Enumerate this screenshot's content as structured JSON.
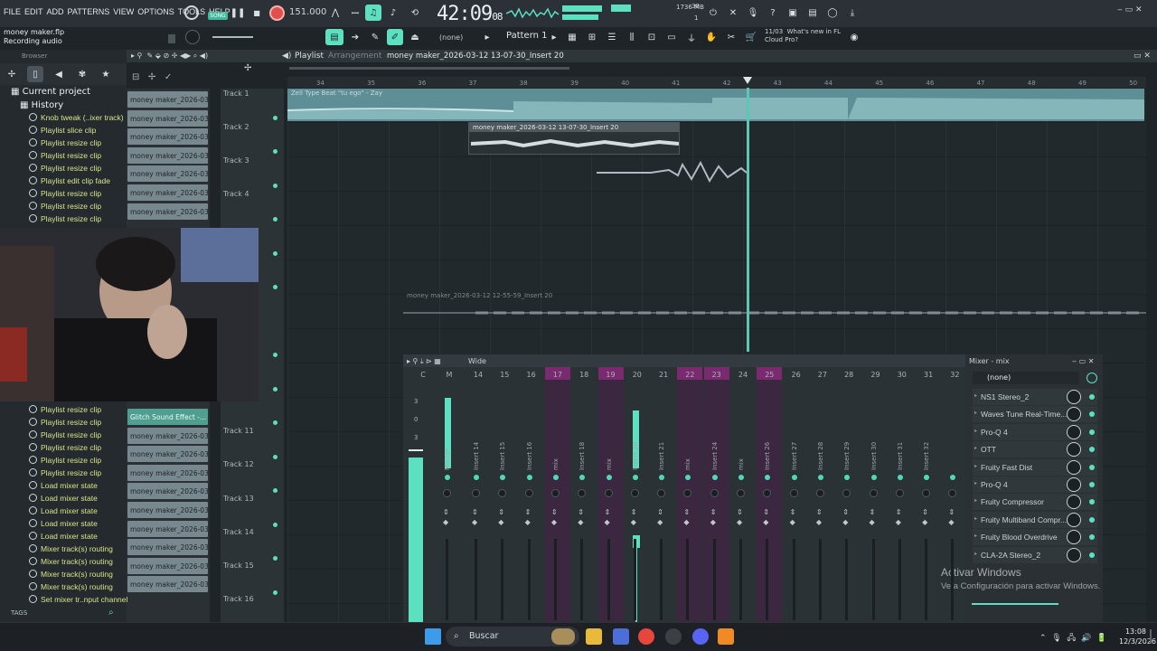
{
  "menu": [
    "FILE",
    "EDIT",
    "ADD",
    "PATTERNS",
    "VIEW",
    "OPTIONS",
    "TOOLS",
    "HELP"
  ],
  "project": {
    "name": "money maker.flp",
    "status": "Recording audio"
  },
  "transport": {
    "tempo": "151.000",
    "time_main": "42:09",
    "time_sub": "08",
    "song_label": "SONG",
    "pattern_label": "PAT"
  },
  "cpu": {
    "top": "38",
    "mem": "1736 MB",
    "bottom": "1"
  },
  "toolbar": {
    "snap": "(none)",
    "pattern": "Pattern 1"
  },
  "news": {
    "date": "11/03",
    "line1": "What's new in FL",
    "line2": "Cloud Pro?"
  },
  "browser": {
    "label": "Browser",
    "current_project": "Current project",
    "history": "History",
    "items_top": [
      "Knob tweak (..ixer track)",
      "Playlist slice clip",
      "Playlist resize clip",
      "Playlist resize clip",
      "Playlist resize clip",
      "Playlist edit clip fade",
      "Playlist resize clip",
      "Playlist resize clip",
      "Playlist resize clip"
    ],
    "items_bottom": [
      "Playlist resize clip",
      "Playlist resize clip",
      "Playlist resize clip",
      "Playlist resize clip",
      "Playlist resize clip",
      "Playlist resize clip",
      "Load mixer state",
      "Load mixer state",
      "Load mixer state",
      "Load mixer state",
      "Load mixer state",
      "Mixer track(s) routing",
      "Mixer track(s) routing",
      "Mixer track(s) routing",
      "Mixer track(s) routing",
      "Set mixer tr..nput channel"
    ],
    "tags": "TAGS"
  },
  "playlist": {
    "title": "Playlist",
    "view": "Arrangement",
    "file": "money maker_2026-03-12 13-07-30_Insert 20",
    "ticks": [
      "34",
      "35",
      "36",
      "37",
      "38",
      "39",
      "40",
      "41",
      "42",
      "43",
      "44",
      "45",
      "46",
      "47",
      "48",
      "49",
      "50"
    ],
    "tracks_top": [
      "Track 1",
      "Track 2",
      "Track 3",
      "Track 4"
    ],
    "tracks_bottom": [
      "Track 11",
      "Track 12",
      "Track 13",
      "Track 14",
      "Track 15",
      "Track 16"
    ],
    "clip_headers_top": [
      "money maker_2026-03-...",
      "money maker_2026-03-...",
      "money maker_2026-03-...",
      "money maker_2026-03-...",
      "money maker_2026-03-...",
      "money maker_2026-03-...",
      "money maker_2026-03-..."
    ],
    "clip_headers_bottom": [
      "Glitch Sound Effect -...",
      "money maker_2026-03-...",
      "money maker_2026-03-...",
      "money maker_2026-03-...",
      "money maker_2026-03-...",
      "money maker_2026-03-...",
      "money maker_2026-03-...",
      "money maker_2026-03-...",
      "money maker_2026-03-...",
      "money maker_2026-03-..."
    ],
    "clips": {
      "beat": "Zell Type Beat \"tu ego\" - Zay",
      "insert20": "money maker_2026-03-12 13-07-30_Insert 20",
      "insert20b": "money maker_2026-03-12 12-55-59_Insert 20"
    }
  },
  "mixer": {
    "title": "Wide",
    "fx_title": "Mixer - mix",
    "db": [
      "3",
      "0",
      "3"
    ],
    "channels": [
      "C",
      "M",
      "14",
      "15",
      "16",
      "17",
      "18",
      "19",
      "20",
      "21",
      "22",
      "23",
      "24",
      "25",
      "26",
      "27",
      "28",
      "29",
      "30",
      "31",
      "32"
    ],
    "names": [
      "Master",
      "Insert 14",
      "Insert 15",
      "Insert 16",
      "mix",
      "Insert 18",
      "mix",
      "Insert 20",
      "Insert 21",
      "mix",
      "Insert 24",
      "mix",
      "Insert 26",
      "Insert 27",
      "Insert 28",
      "Insert 29",
      "Insert 30",
      "Insert 31",
      "Insert 32"
    ],
    "fx_none": "(none)",
    "fx_slots": [
      "NS1 Stereo_2",
      "Waves Tune Real-Time...",
      "Pro-Q 4",
      "OTT",
      "Fruity Fast Dist",
      "Pro-Q 4",
      "Fruity Compressor",
      "Fruity Multiband Compr...",
      "Fruity Blood Overdrive",
      "CLA-2A Stereo_2"
    ]
  },
  "watermark": {
    "line1": "Activar Windows",
    "line2": "Ve a Configuración para activar Windows."
  },
  "taskbar": {
    "search": "Buscar",
    "time": "13:08",
    "date": "12/3/2026"
  },
  "colors": {
    "accent": "#5de0c0",
    "bg": "#1f2428",
    "pink_strip": "#7a2a6f"
  }
}
